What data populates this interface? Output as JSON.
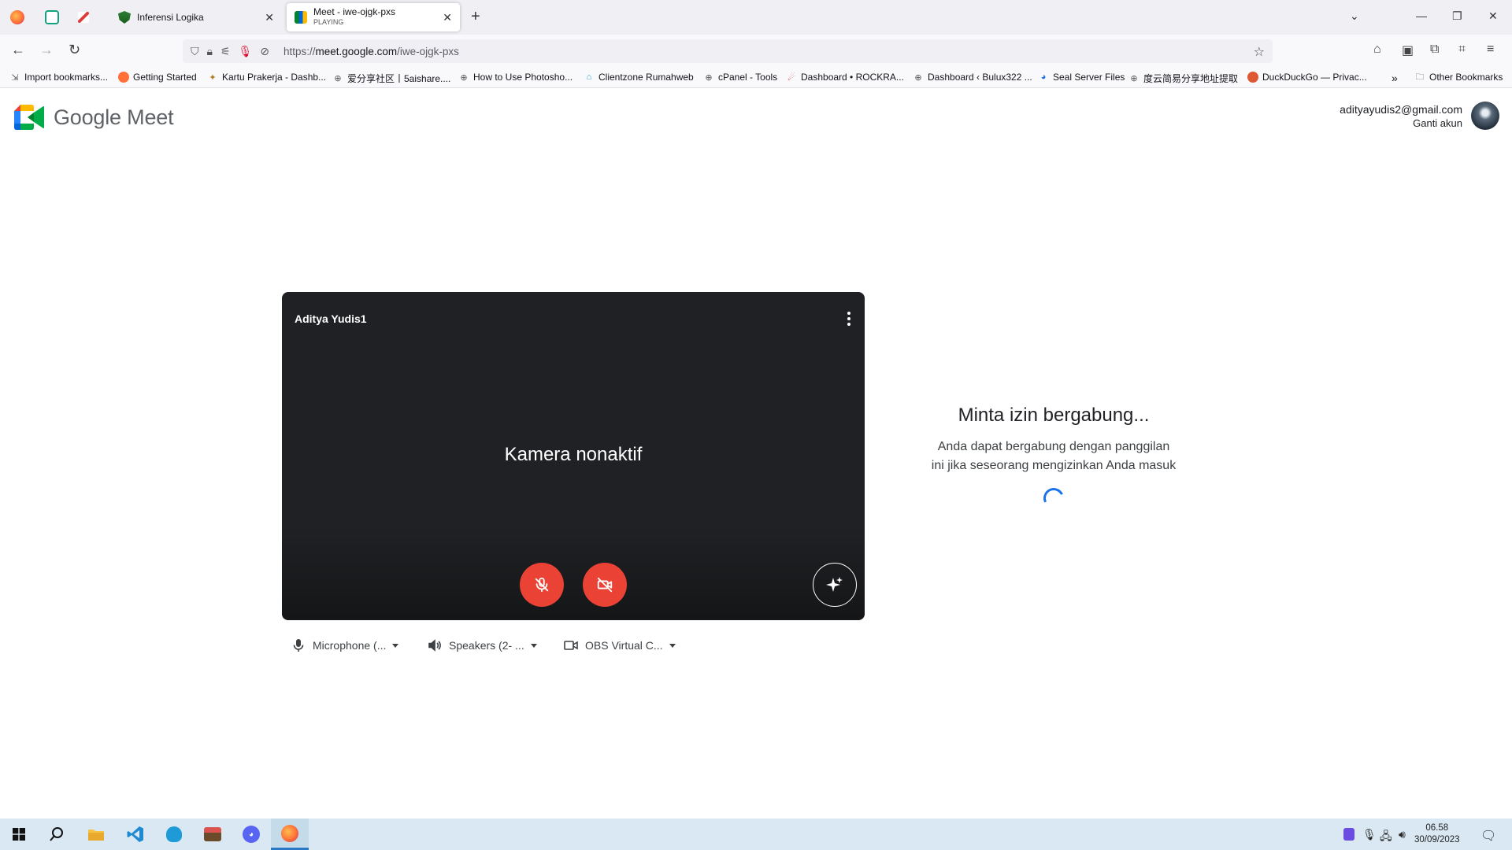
{
  "browser": {
    "tabs": [
      {
        "title": "Inferensi Logika",
        "subtitle": ""
      },
      {
        "title": "Meet - iwe-ojgk-pxs",
        "subtitle": "PLAYING"
      }
    ],
    "url_prefix": "https://",
    "url_domain": "meet.google.com",
    "url_path": "/iwe-ojgk-pxs",
    "bookmarks": [
      "Import bookmarks...",
      "Getting Started",
      "Kartu Prakerja - Dashb...",
      "爱分享社区丨5aishare....",
      "How to Use Photosho...",
      "Clientzone Rumahweb",
      "cPanel - Tools",
      "Dashboard • ROCKRA...",
      "Dashboard ‹ Bulux322 ...",
      "Seal Server Files",
      "度云简易分享地址提取",
      "DuckDuckGo — Privac...",
      "Other Bookmarks"
    ]
  },
  "header": {
    "logo_text": "Google Meet",
    "account_email": "adityayudis2@gmail.com",
    "switch_account": "Ganti akun"
  },
  "preview": {
    "participant_name": "Aditya Yudis1",
    "camera_off_text": "Kamera nonaktif"
  },
  "devices": {
    "microphone": "Microphone (...",
    "speakers": "Speakers (2- ...",
    "camera": "OBS Virtual C..."
  },
  "join": {
    "title": "Minta izin bergabung...",
    "description": "Anda dapat bergabung dengan panggilan ini jika seseorang mengizinkan Anda masuk"
  },
  "taskbar": {
    "time": "06.58",
    "date": "30/09/2023"
  },
  "colors": {
    "mute_red": "#ea4335",
    "tile_bg": "#202124",
    "spinner_blue": "#1a73e8",
    "taskbar_bg": "#d9e8f2"
  }
}
